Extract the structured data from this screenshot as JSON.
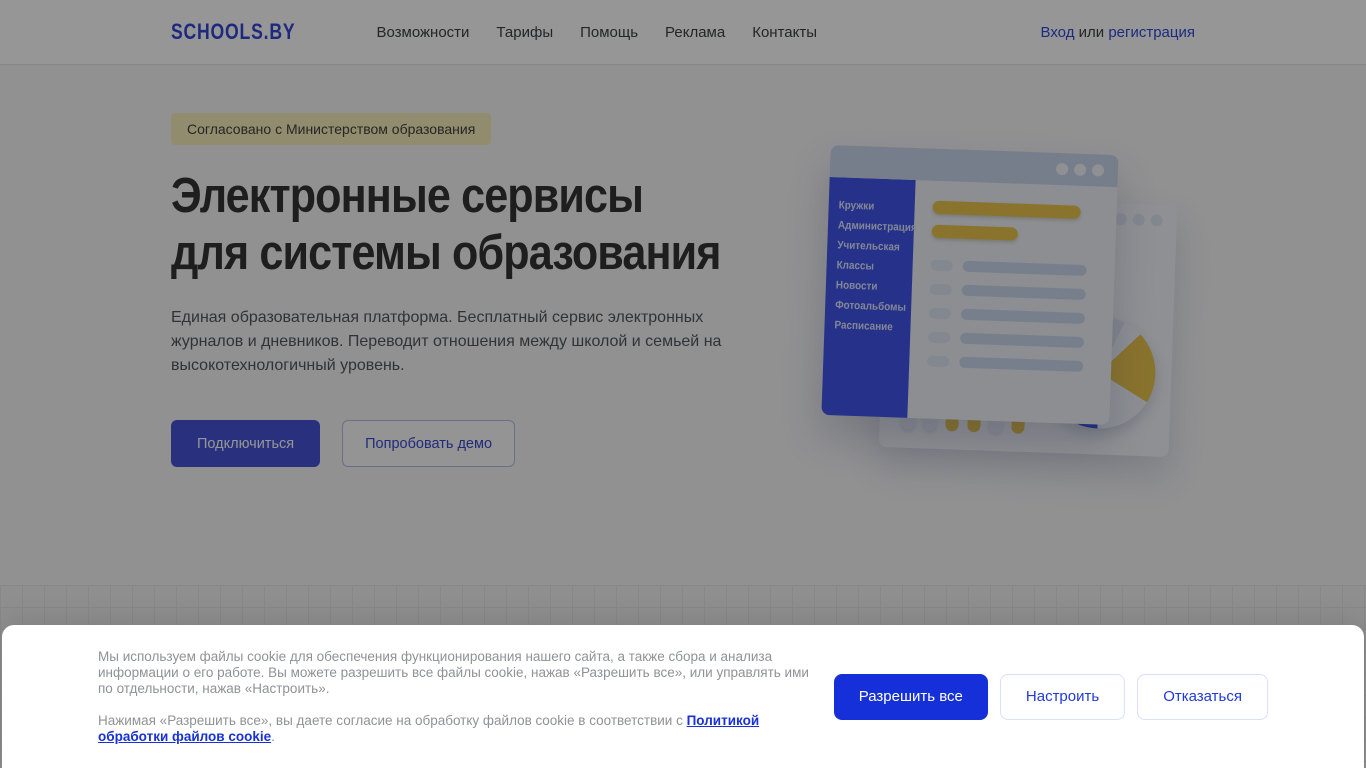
{
  "header": {
    "logo": "SCHOOLS.BY",
    "nav": [
      "Возможности",
      "Тарифы",
      "Помощь",
      "Реклама",
      "Контакты"
    ],
    "auth": {
      "login": "Вход",
      "separator": "или",
      "register": "регистрация"
    }
  },
  "hero": {
    "badge": "Согласовано с Министерством образования",
    "title_line1": "Электронные сервисы",
    "title_line2": "для системы образования",
    "description": "Единая образовательная платформа. Бесплатный сервис электронных журналов и дневников. Переводит отношения между школой и семьей на высокотехнологичный уровень.",
    "primary_button": "Подключиться",
    "secondary_button": "Попробовать демо"
  },
  "illustration": {
    "menu_items": [
      "Кружки",
      "Администрация",
      "Учительская",
      "Классы",
      "Новости",
      "Фотоальбомы",
      "Расписание"
    ],
    "icons": [
      "window-control-dots",
      "bar-chart",
      "pie-chart"
    ]
  },
  "cookie_banner": {
    "paragraph1": "Мы используем файлы cookie для обеспечения функционирования нашего сайта, а также сбора и анализа информации о его работе. Вы можете разрешить все файлы cookie, нажав «Разрешить все», или управлять ими по отдельности, нажав «Настроить».",
    "paragraph2_prefix": "Нажимая «Разрешить все», вы даете согласие на обработку файлов cookie в соответствии с ",
    "paragraph2_link": "Политикой обработки файлов cookie",
    "paragraph2_suffix": ".",
    "allow_button": "Разрешить все",
    "configure_button": "Настроить",
    "decline_button": "Отказаться"
  },
  "colors": {
    "brand_blue": "#3347d6",
    "hero_button_blue": "#4653d6",
    "cookie_primary_blue": "#1530d8",
    "badge_yellow": "#f8efbd",
    "illustration_yellow": "#e9c44d",
    "illustration_sidebar_blue": "#4155ea",
    "dim_overlay": "rgba(0,0,0,0.41)"
  }
}
